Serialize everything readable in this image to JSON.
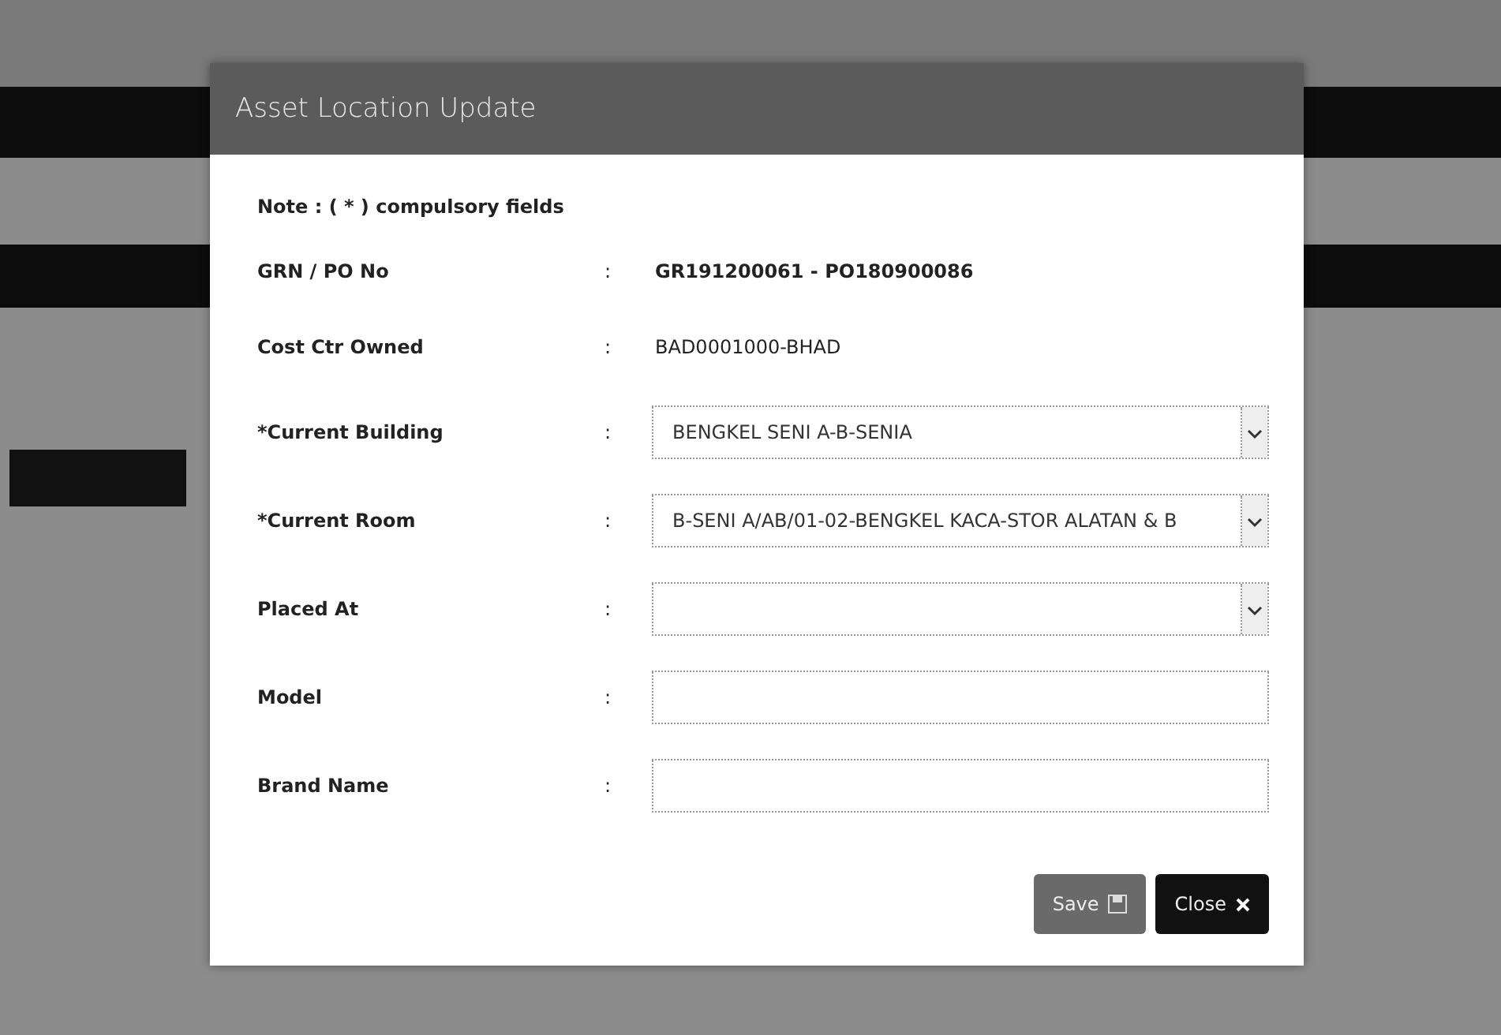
{
  "modal": {
    "title": "Asset Location Update",
    "note": "Note : ( * ) compulsory fields",
    "fields": [
      {
        "label": "GRN / PO No",
        "separator": ":",
        "kind": "static",
        "bold": true,
        "value": "GR191200061 - PO180900086"
      },
      {
        "label": "Cost Ctr Owned",
        "separator": ":",
        "kind": "static",
        "bold": false,
        "value": "BAD0001000-BHAD"
      },
      {
        "label": "*Current Building",
        "separator": ":",
        "kind": "select",
        "value": "BENGKEL SENI A-B-SENIA"
      },
      {
        "label": "*Current Room",
        "separator": ":",
        "kind": "select",
        "value": "B-SENI A/AB/01-02-BENGKEL KACA-STOR ALATAN & B"
      },
      {
        "label": "Placed At",
        "separator": ":",
        "kind": "select"
      },
      {
        "label": "Model",
        "separator": ":",
        "kind": "input"
      },
      {
        "label": "Brand Name",
        "separator": ":",
        "kind": "input"
      }
    ],
    "buttons": [
      {
        "label": "Save",
        "kind": "save"
      },
      {
        "label": "Close",
        "kind": "close"
      }
    ]
  }
}
